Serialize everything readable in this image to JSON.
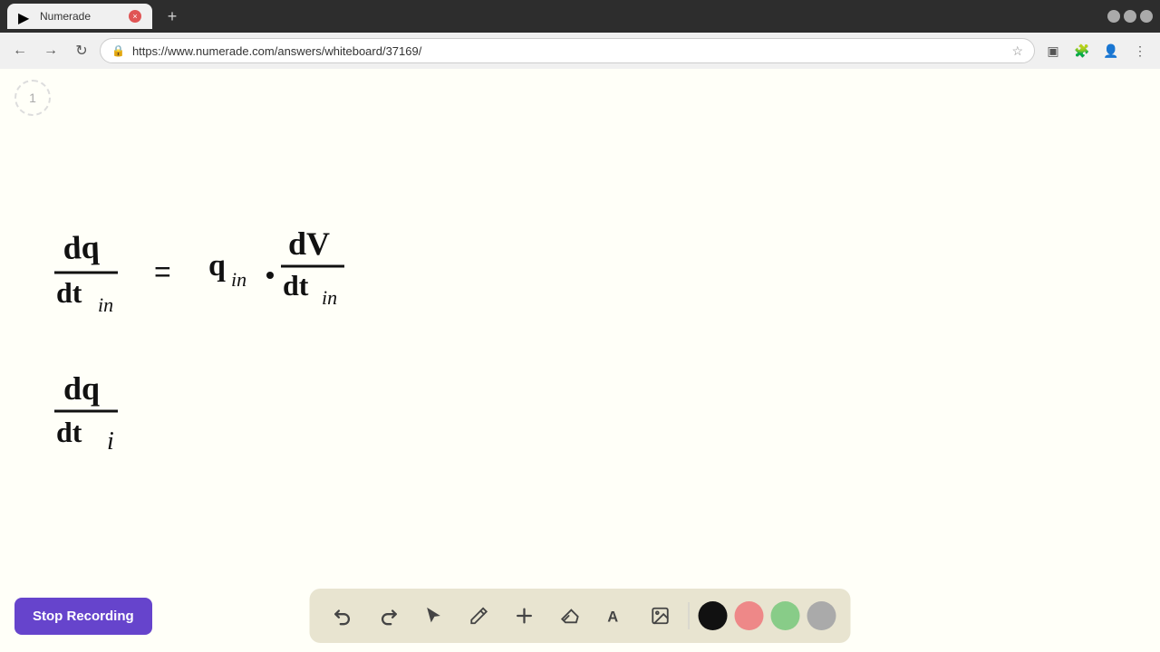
{
  "browser": {
    "tab_title": "Numerade",
    "tab_favicon": "▶",
    "url": "https://www.numerade.com/answers/whiteboard/37169/",
    "new_tab_label": "+",
    "nav": {
      "back": "←",
      "forward": "→",
      "refresh": "↺"
    }
  },
  "page": {
    "number": "1"
  },
  "toolbar": {
    "undo_label": "↺",
    "redo_label": "↻",
    "select_label": "⬆",
    "pen_label": "✎",
    "add_label": "+",
    "eraser_label": "⌫",
    "text_label": "A",
    "image_label": "🖼",
    "stop_recording_label": "Stop Recording"
  },
  "colors": {
    "black": "#111111",
    "pink": "#e88888",
    "green": "#88cc88",
    "gray": "#aaaaaa"
  }
}
